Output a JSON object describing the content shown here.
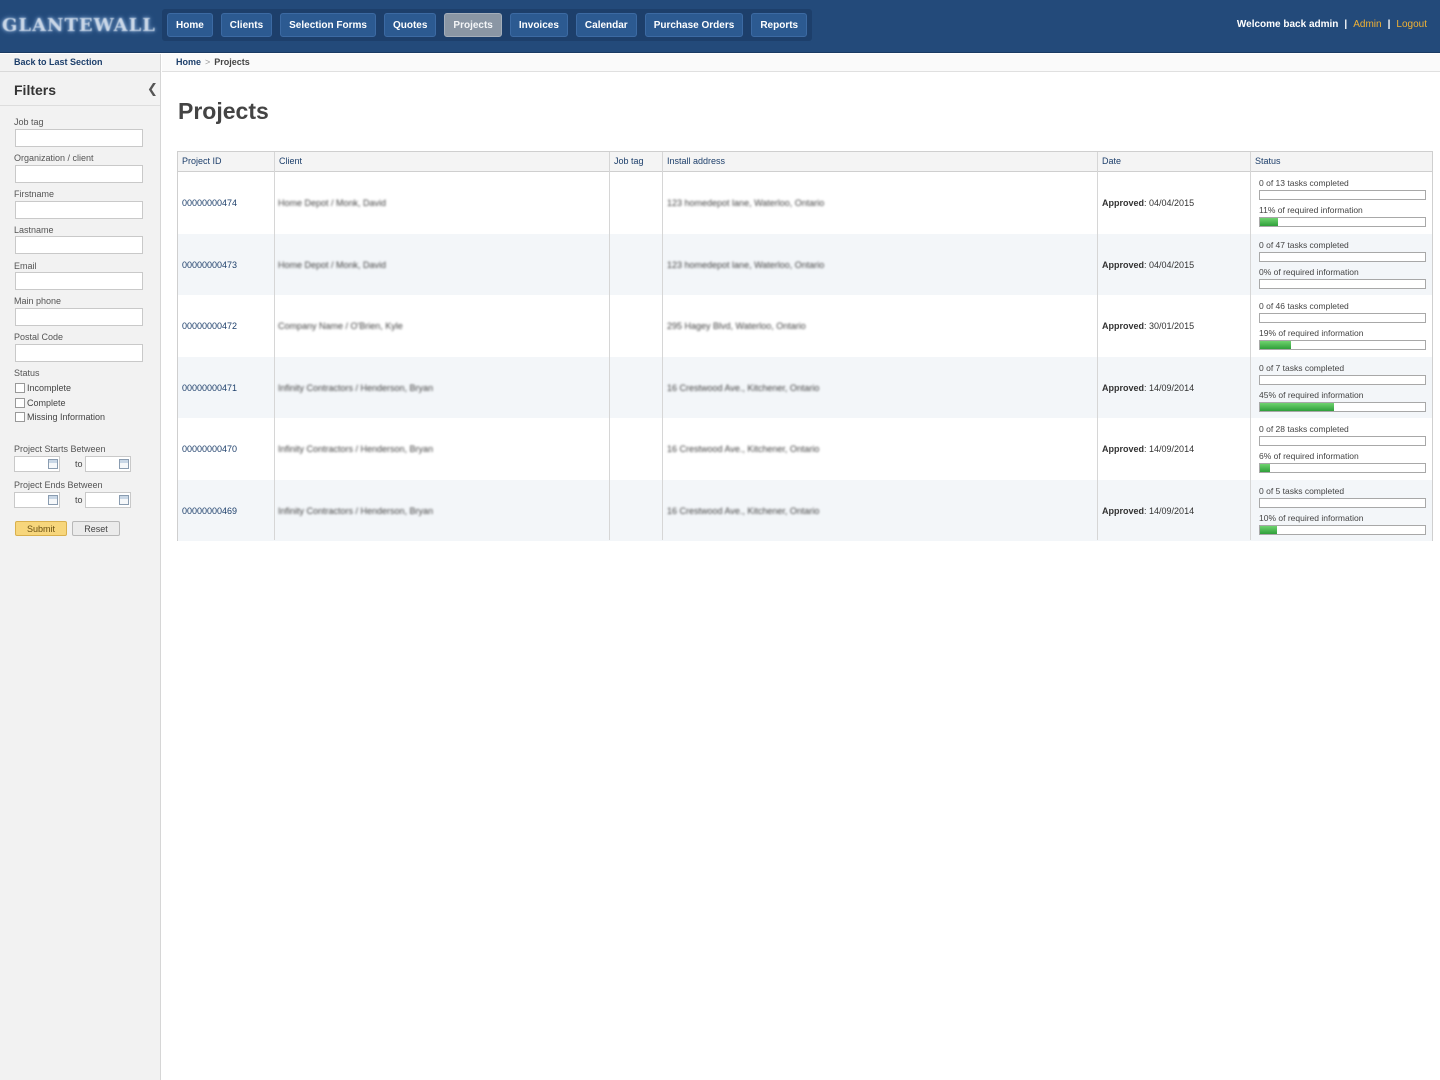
{
  "header": {
    "logo_text": "GLANTEWALL",
    "nav": [
      "Home",
      "Clients",
      "Selection Forms",
      "Quotes",
      "Projects",
      "Invoices",
      "Calendar",
      "Purchase Orders",
      "Reports"
    ],
    "active_nav": "Projects",
    "welcome": "Welcome back admin",
    "admin_link": "Admin",
    "logout_link": "Logout",
    "separator": "|"
  },
  "sidebar": {
    "back_link": "Back to Last Section",
    "title": "Filters",
    "fields": {
      "job_tag": "Job tag",
      "org_client": "Organization / client",
      "firstname": "Firstname",
      "lastname": "Lastname",
      "email": "Email",
      "main_phone": "Main phone",
      "postal_code": "Postal Code"
    },
    "status_label": "Status",
    "status_options": [
      "Incomplete",
      "Complete",
      "Missing Information"
    ],
    "starts_label": "Project Starts Between",
    "ends_label": "Project Ends Between",
    "to_label": "to",
    "submit": "Submit",
    "reset": "Reset"
  },
  "breadcrumb": {
    "home": "Home",
    "sep": ">",
    "current": "Projects"
  },
  "page": {
    "title": "Projects"
  },
  "table": {
    "headers": [
      "Project ID",
      "Client",
      "Job tag",
      "Install address",
      "Date",
      "Status"
    ],
    "date_prefix": "Approved",
    "rows": [
      {
        "id": "00000000474",
        "client": "Home Depot / Monk, David",
        "job_tag": "",
        "address": "123 homedepot lane, Waterloo, Ontario",
        "date": "04/04/2015",
        "tasks": "0 of 13 tasks completed",
        "info": "11% of required information",
        "info_pct": 11
      },
      {
        "id": "00000000473",
        "client": "Home Depot / Monk, David",
        "job_tag": "",
        "address": "123 homedepot lane, Waterloo, Ontario",
        "date": "04/04/2015",
        "tasks": "0 of 47 tasks completed",
        "info": "0% of required information",
        "info_pct": 0
      },
      {
        "id": "00000000472",
        "client": "Company Name / O'Brien, Kyle",
        "job_tag": "",
        "address": "295 Hagey Blvd, Waterloo, Ontario",
        "date": "30/01/2015",
        "tasks": "0 of 46 tasks completed",
        "info": "19% of required information",
        "info_pct": 19
      },
      {
        "id": "00000000471",
        "client": "Infinity Contractors / Henderson, Bryan",
        "job_tag": "",
        "address": "16 Crestwood Ave., Kitchener, Ontario",
        "date": "14/09/2014",
        "tasks": "0 of 7 tasks completed",
        "info": "45% of required information",
        "info_pct": 45
      },
      {
        "id": "00000000470",
        "client": "Infinity Contractors / Henderson, Bryan",
        "job_tag": "",
        "address": "16 Crestwood Ave., Kitchener, Ontario",
        "date": "14/09/2014",
        "tasks": "0 of 28 tasks completed",
        "info": "6% of required information",
        "info_pct": 6
      },
      {
        "id": "00000000469",
        "client": "Infinity Contractors / Henderson, Bryan",
        "job_tag": "",
        "address": "16 Crestwood Ave., Kitchener, Ontario",
        "date": "14/09/2014",
        "tasks": "0 of 5 tasks completed",
        "info": "10% of required information",
        "info_pct": 10
      }
    ]
  }
}
